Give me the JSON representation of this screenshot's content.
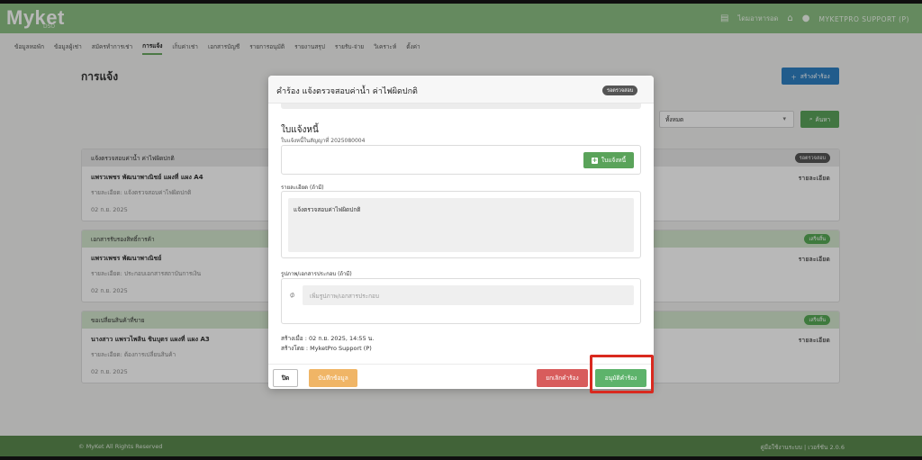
{
  "app": {
    "logo": "Myket",
    "logo_sub": "DSO",
    "top_links": {
      "notifications": "ไดมอาหารอด",
      "user": "MYKETPRO SUPPORT (P)"
    }
  },
  "nav": {
    "tabs": [
      {
        "label": "ข้อมูลหอพัก"
      },
      {
        "label": "ข้อมูลผู้เช่า"
      },
      {
        "label": "สมัครทำการเช่า"
      },
      {
        "label": "การแจ้ง",
        "active": true
      },
      {
        "label": "เก็บค่าเช่า"
      },
      {
        "label": "เอกสารบัญชี"
      },
      {
        "label": "รายการอนุมัติ"
      },
      {
        "label": "รายงานสรุป"
      },
      {
        "label": "รายรับ-จ่าย"
      },
      {
        "label": "วิเคราะห์"
      },
      {
        "label": "ตั้งค่า"
      }
    ]
  },
  "page": {
    "title": "การแจ้ง",
    "create_button": "สร้างคำร้อง",
    "filter_value": "ทั้งหมด",
    "search_button": "ค้นหา"
  },
  "cards": [
    {
      "header": "แจ้งตรวจสอบค่าน้ำ ค่าไฟผิดปกติ",
      "badge": "รอตรวจสอบ",
      "title": "แพรวเพชร พัฒนาพาณิชย์ แผงที่ แผง A4",
      "detail": "รายละเอียด: แจ้งตรวจสอบค่าไฟผิดปกติ",
      "date": "02 ก.ย. 2025",
      "link": "รายละเอียด"
    },
    {
      "header": "เอกสารรับรองสิทธิ์การค้า",
      "badge": "เสร็จสิ้น",
      "title": "แพรวเพชร พัฒนาพาณิชย์",
      "detail": "รายละเอียด: ประกอบเอกสารสถาบันการเงิน",
      "date": "02 ก.ย. 2025",
      "link": "รายละเอียด"
    },
    {
      "header": "ขอเปลี่ยนสินค้าที่ขาย",
      "badge": "เสร็จสิ้น",
      "title": "นางสาว แพรวไพลิน ชินบุตร แผงที่ แผง A3",
      "detail": "รายละเอียด: ต้องการเปลี่ยนสินค้า",
      "date": "02 ก.ย. 2025",
      "link": "รายละเอียด"
    }
  ],
  "modal": {
    "title": "คำร้อง แจ้งตรวจสอบค่าน้ำ ค่าไฟผิดปกติ",
    "badge": "รอตรวจสอบ",
    "invoice_title": "ใบแจ้งหนี้",
    "invoice_sub": "ใบแจ้งหนี้ในสัญญาที่ 2025080004",
    "invoice_button": "ใบแจ้งหนี้",
    "details_label": "รายละเอียด (ถ้ามี)",
    "details_value": "แจ้งตรวจสอบค่าไฟผิดปกติ",
    "attach_label": "รูปภาพ/เอกสารประกอบ (ถ้ามี)",
    "attach_placeholder": "เพิ่มรูปภาพ/เอกสารประกอบ",
    "created_at": "สร้างเมื่อ : 02 ก.ย. 2025, 14:55 น.",
    "created_by": "สร้างโดย : MyketPro Support (P)",
    "buttons": {
      "close": "ปิด",
      "save": "บันทึกข้อมูล",
      "cancel": "ยกเลิกคำร้อง",
      "approve": "อนุมัติคำร้อง"
    }
  },
  "footer": {
    "left": "© MyKet All Rights Reserved",
    "right": "คู่มือใช้งานระบบ | เวอร์ชัน 2.0.6"
  },
  "colors": {
    "brand_green": "#8cc084",
    "footer_green": "#5a8a4e",
    "approve_green": "#5db36b",
    "cancel_red": "#d85c5c",
    "save_orange": "#f0b566",
    "highlight_red": "#d9291f"
  }
}
